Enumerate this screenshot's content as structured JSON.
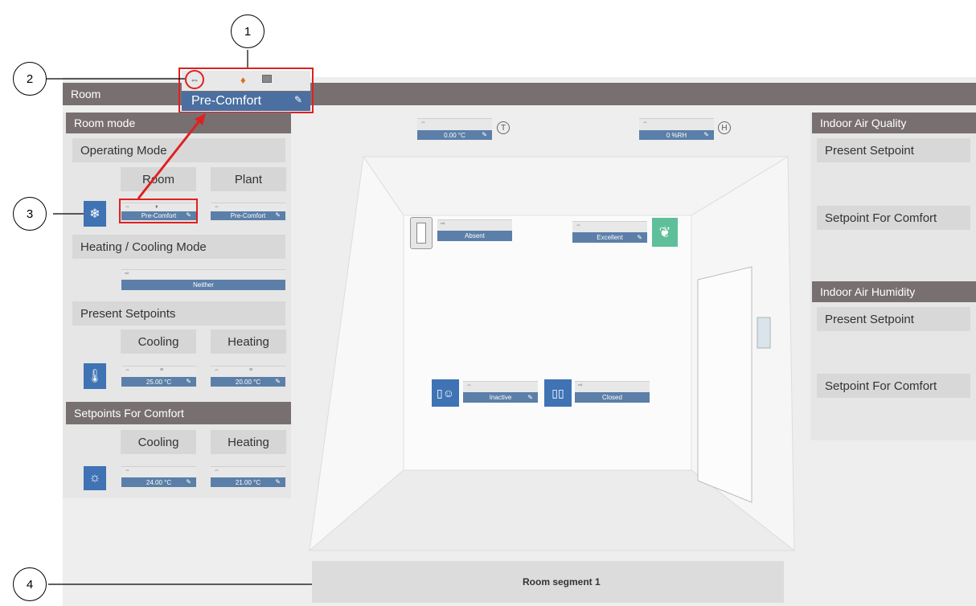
{
  "room_bar": {
    "title": "Room"
  },
  "popup": {
    "mode_value": "Pre-Comfort",
    "pencil": "✎"
  },
  "left": {
    "room_mode_title": "Room mode",
    "operating_mode_label": "Operating Mode",
    "room_col": "Room",
    "plant_col": "Plant",
    "room_value": "Pre-Comfort",
    "plant_value": "Pre-Comfort",
    "hc_mode_label": "Heating / Cooling Mode",
    "hc_value": "Neither",
    "present_setpoints_label": "Present Setpoints",
    "cooling_label": "Cooling",
    "heating_label": "Heating",
    "cooling_setpoint": "25.00 °C",
    "heating_setpoint": "20.00 °C",
    "comfort_title": "Setpoints For Comfort",
    "comfort_cooling_label": "Cooling",
    "comfort_heating_label": "Heating",
    "comfort_cooling_value": "24.00 °C",
    "comfort_heating_value": "21.00 °C"
  },
  "center": {
    "temperature": "0.00 °C",
    "humidity": "0 %RH",
    "temp_badge": "T",
    "humidity_badge": "H",
    "presence_value": "Absent",
    "air_quality_value": "Excellent",
    "occupancy_value": "Inactive",
    "window_value": "Closed",
    "segment": "Room segment 1"
  },
  "right": {
    "iaq_title": "Indoor Air Quality",
    "iaq_present": "Present Setpoint",
    "iaq_comfort": "Setpoint For Comfort",
    "iah_title": "Indoor Air Humidity",
    "iah_present": "Present Setpoint",
    "iah_comfort": "Setpoint For Comfort"
  },
  "callouts": {
    "c1": "1",
    "c2": "2",
    "c3": "3",
    "c4": "4"
  },
  "colors": {
    "accent_blue": "#5b7fa8",
    "header_grey": "#787070",
    "highlight_red": "#e02020",
    "leaf_green": "#5fbf9a"
  },
  "icons": [
    "cycle-icon",
    "flame-icon",
    "display-icon",
    "pencil-icon",
    "snowflake-icon",
    "thermometer-icon",
    "sun-icon",
    "leaf-icon",
    "presence-sensor-icon",
    "person-door-icon",
    "window-icon"
  ]
}
